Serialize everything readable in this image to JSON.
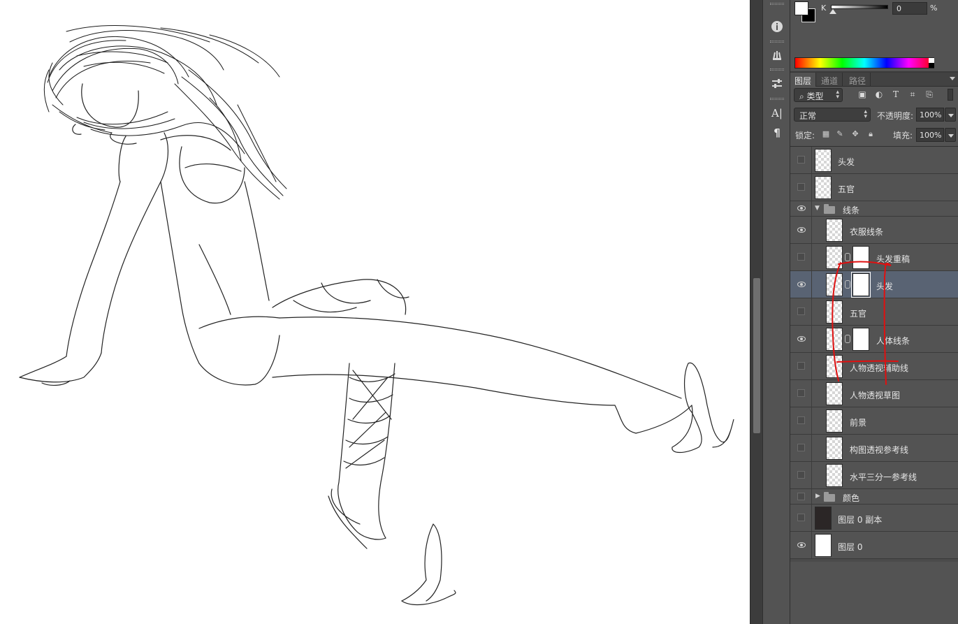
{
  "color_panel": {
    "foreground": "#ffffff",
    "background": "#000000",
    "channel_label": "K",
    "channel_value": "0",
    "channel_unit": "%"
  },
  "panel_tabs": [
    {
      "label": "图层",
      "active": true
    },
    {
      "label": "通道",
      "active": false
    },
    {
      "label": "路径",
      "active": false
    }
  ],
  "filter": {
    "kind_label": "类型"
  },
  "blend": {
    "mode": "正常",
    "opacity_label": "不透明度:",
    "opacity_value": "100%",
    "lock_label": "锁定:",
    "fill_label": "填充:",
    "fill_value": "100%"
  },
  "layers": [
    {
      "name": "头发",
      "visible": false
    },
    {
      "name": "五官",
      "visible": false
    },
    {
      "name": "线条",
      "visible": true,
      "group": true,
      "expanded": true
    },
    {
      "name": "衣服线条",
      "visible": true
    },
    {
      "name": "头发重稿",
      "visible": false,
      "mask": true
    },
    {
      "name": "头发",
      "visible": true,
      "mask": true,
      "selected": true
    },
    {
      "name": "五官",
      "visible": false
    },
    {
      "name": "人体线条",
      "visible": true,
      "mask": true
    },
    {
      "name": "人物透视辅助线",
      "visible": false
    },
    {
      "name": "人物透视草图",
      "visible": false
    },
    {
      "name": "前景",
      "visible": false
    },
    {
      "name": "构图透视参考线",
      "visible": false
    },
    {
      "name": "水平三分一参考线",
      "visible": false
    },
    {
      "name": "颜色",
      "visible": false,
      "group": true,
      "expanded": false
    },
    {
      "name": "图层 0 副本",
      "visible": false
    },
    {
      "name": "图层 0",
      "visible": true
    }
  ],
  "colors": {
    "panel_bg": "#535353",
    "selected_row": "#596373",
    "annotation_red": "#e01010"
  }
}
